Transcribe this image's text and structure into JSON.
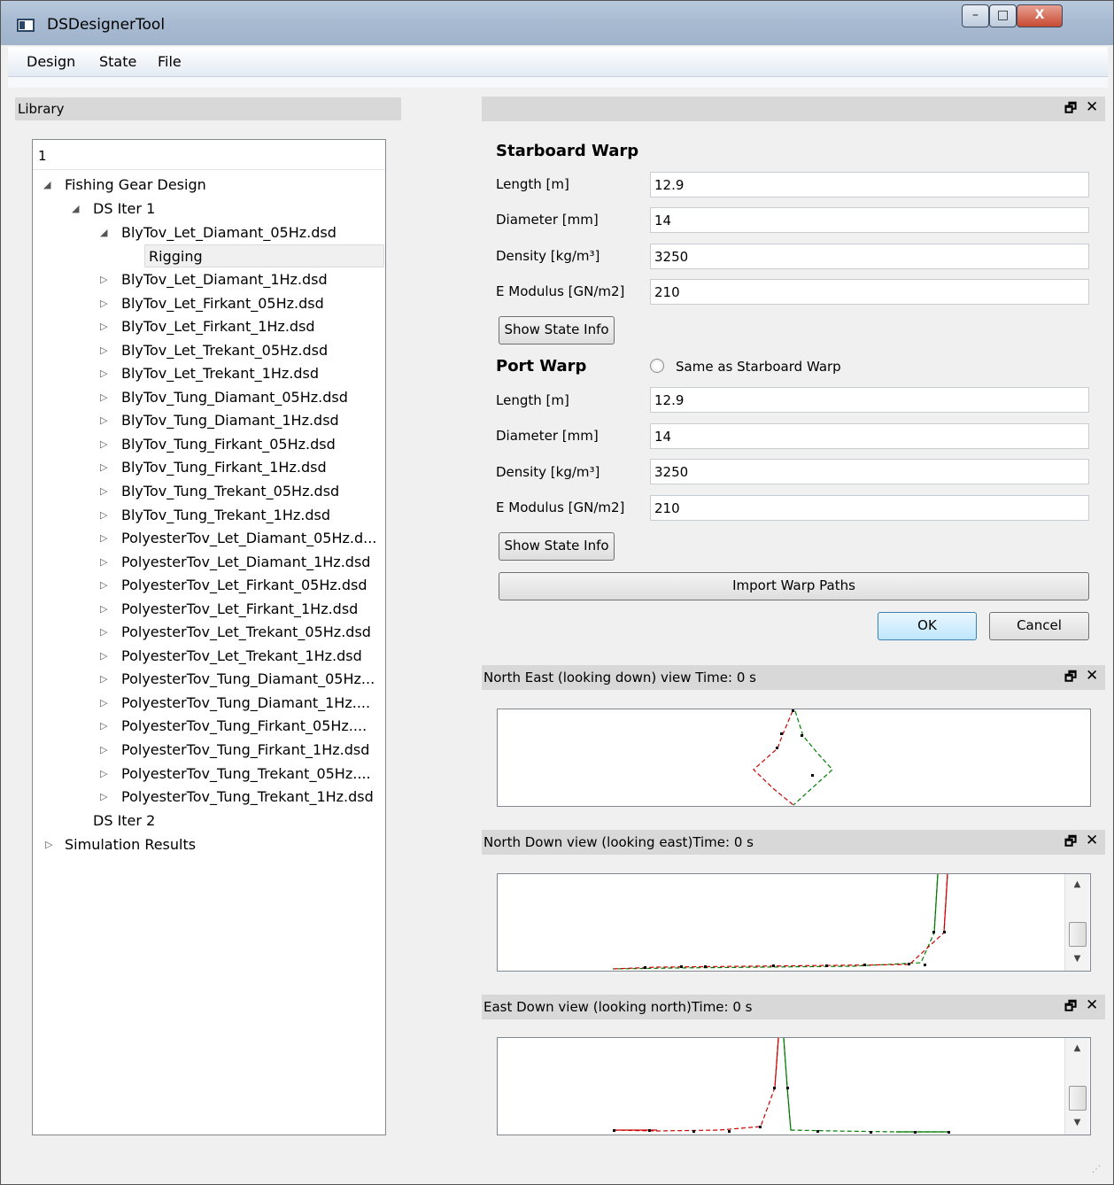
{
  "window": {
    "title": "DSDesignerTool",
    "controls": {
      "minimize": "–",
      "maximize": "□",
      "close": "X"
    }
  },
  "menubar": {
    "items": [
      "Design",
      "State",
      "File"
    ]
  },
  "library": {
    "title": "Library",
    "tree_header": "1",
    "tree": {
      "root": "Fishing Gear Design",
      "iter1": "DS Iter 1",
      "expanded_file": "BlyTov_Let_Diamant_05Hz.dsd",
      "selected_child": "Rigging",
      "files": [
        "BlyTov_Let_Diamant_1Hz.dsd",
        "BlyTov_Let_Firkant_05Hz.dsd",
        "BlyTov_Let_Firkant_1Hz.dsd",
        "BlyTov_Let_Trekant_05Hz.dsd",
        "BlyTov_Let_Trekant_1Hz.dsd",
        "BlyTov_Tung_Diamant_05Hz.dsd",
        "BlyTov_Tung_Diamant_1Hz.dsd",
        "BlyTov_Tung_Firkant_05Hz.dsd",
        "BlyTov_Tung_Firkant_1Hz.dsd",
        "BlyTov_Tung_Trekant_05Hz.dsd",
        "BlyTov_Tung_Trekant_1Hz.dsd",
        "PolyesterTov_Let_Diamant_05Hz.d...",
        "PolyesterTov_Let_Diamant_1Hz.dsd",
        "PolyesterTov_Let_Firkant_05Hz.dsd",
        "PolyesterTov_Let_Firkant_1Hz.dsd",
        "PolyesterTov_Let_Trekant_05Hz.dsd",
        "PolyesterTov_Let_Trekant_1Hz.dsd",
        "PolyesterTov_Tung_Diamant_05Hz...",
        "PolyesterTov_Tung_Diamant_1Hz....",
        "PolyesterTov_Tung_Firkant_05Hz....",
        "PolyesterTov_Tung_Firkant_1Hz.dsd",
        "PolyesterTov_Tung_Trekant_05Hz....",
        "PolyesterTov_Tung_Trekant_1Hz.dsd"
      ],
      "iter2": "DS Iter 2",
      "sim_results": "Simulation Results"
    }
  },
  "form_dock": {
    "title": "",
    "float_icon": "🗗",
    "close_icon": "✕"
  },
  "starboard": {
    "title": "Starboard Warp",
    "length_label": "Length  [m]",
    "length_value": "12.9",
    "diameter_label": "Diameter [mm]",
    "diameter_value": "14",
    "density_label": "Density [kg/m³]",
    "density_value": "3250",
    "emod_label": "E Modulus  [GN/m2]",
    "emod_value": "210",
    "state_btn": "Show State Info"
  },
  "port": {
    "title": "Port Warp",
    "same_as_label": "Same as Starboard Warp",
    "same_as_checked": false,
    "length_label": "Length [m]",
    "length_value": "12.9",
    "diameter_label": "Diameter [mm]",
    "diameter_value": "14",
    "density_label": "Density [kg/m³]",
    "density_value": "3250",
    "emod_label": "E Modulus [GN/m2]",
    "emod_value": "210",
    "state_btn": "Show State Info"
  },
  "buttons": {
    "import": "Import Warp Paths",
    "ok": "OK",
    "cancel": "Cancel"
  },
  "views": {
    "ne": {
      "title": "North East (looking down) view Time: 0 s"
    },
    "nd": {
      "title": "North Down view (looking east)Time: 0 s"
    },
    "ed": {
      "title": "East Down view (looking north)Time: 0 s"
    }
  },
  "colors": {
    "starboard_path": "#cc0000",
    "port_path": "#007a00"
  }
}
